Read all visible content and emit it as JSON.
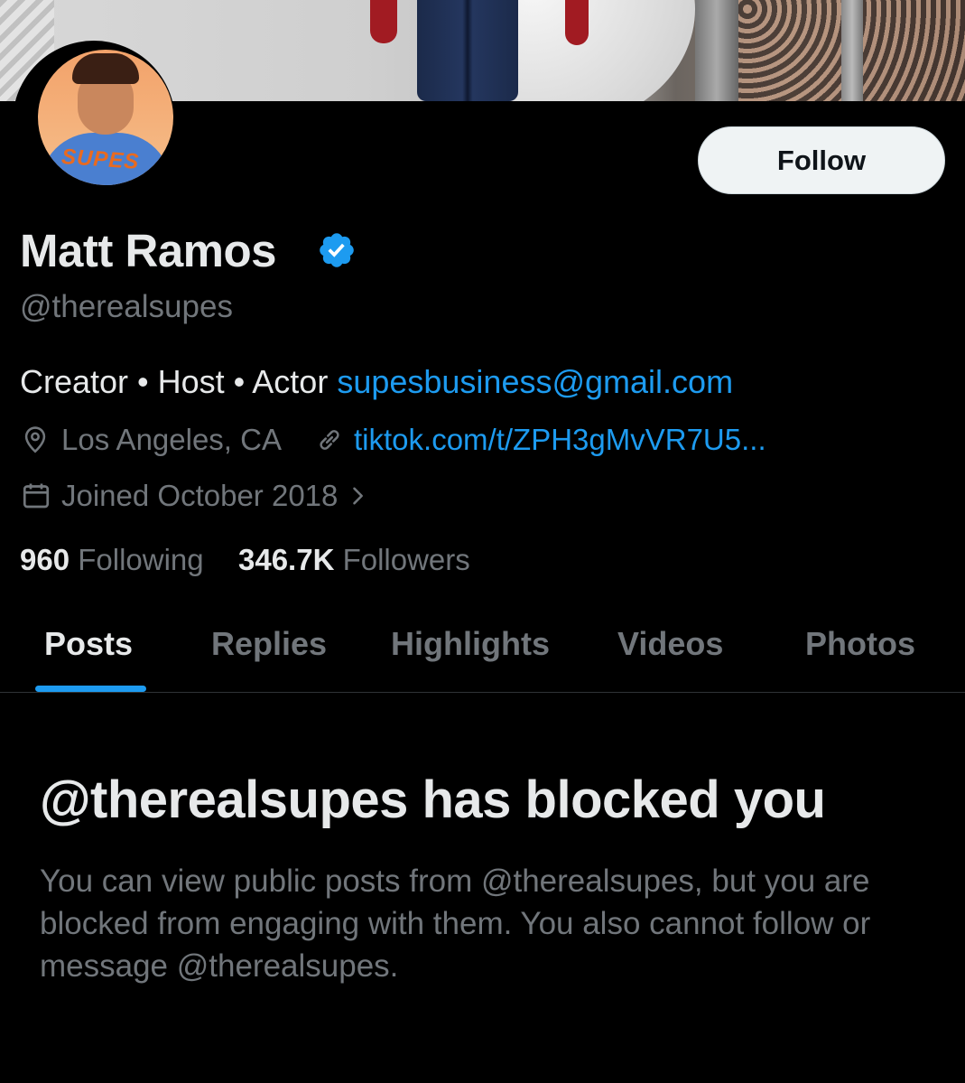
{
  "profile": {
    "name": "Matt Ramos",
    "handle": "@therealsupes",
    "bio_text": "Creator • Host • Actor ",
    "bio_link": "supesbusiness@gmail.com",
    "location": "Los Angeles, CA",
    "website": "tiktok.com/t/ZPH3gMvVR7U5...",
    "joined": "Joined October 2018",
    "avatar_shirt_text": "SUPES"
  },
  "actions": {
    "follow_label": "Follow"
  },
  "stats": {
    "following_count": "960",
    "following_label": "Following",
    "followers_count": "346.7K",
    "followers_label": "Followers"
  },
  "tabs": [
    {
      "label": "Posts",
      "active": true
    },
    {
      "label": "Replies"
    },
    {
      "label": "Highlights"
    },
    {
      "label": "Videos"
    },
    {
      "label": "Photos"
    }
  ],
  "blocked": {
    "title": "@therealsupes has blocked you",
    "description": "You can view public posts from @therealsupes, but you are blocked from engaging with them. You also cannot follow or message @therealsupes."
  },
  "colors": {
    "accent": "#1d9bf0",
    "background": "#000000",
    "text_primary": "#e7e9ea",
    "text_secondary": "#71767b"
  },
  "icons": {
    "verified": "verified-badge-icon",
    "location": "location-pin-icon",
    "website": "link-icon",
    "joined": "calendar-icon",
    "expand": "chevron-right-icon"
  }
}
